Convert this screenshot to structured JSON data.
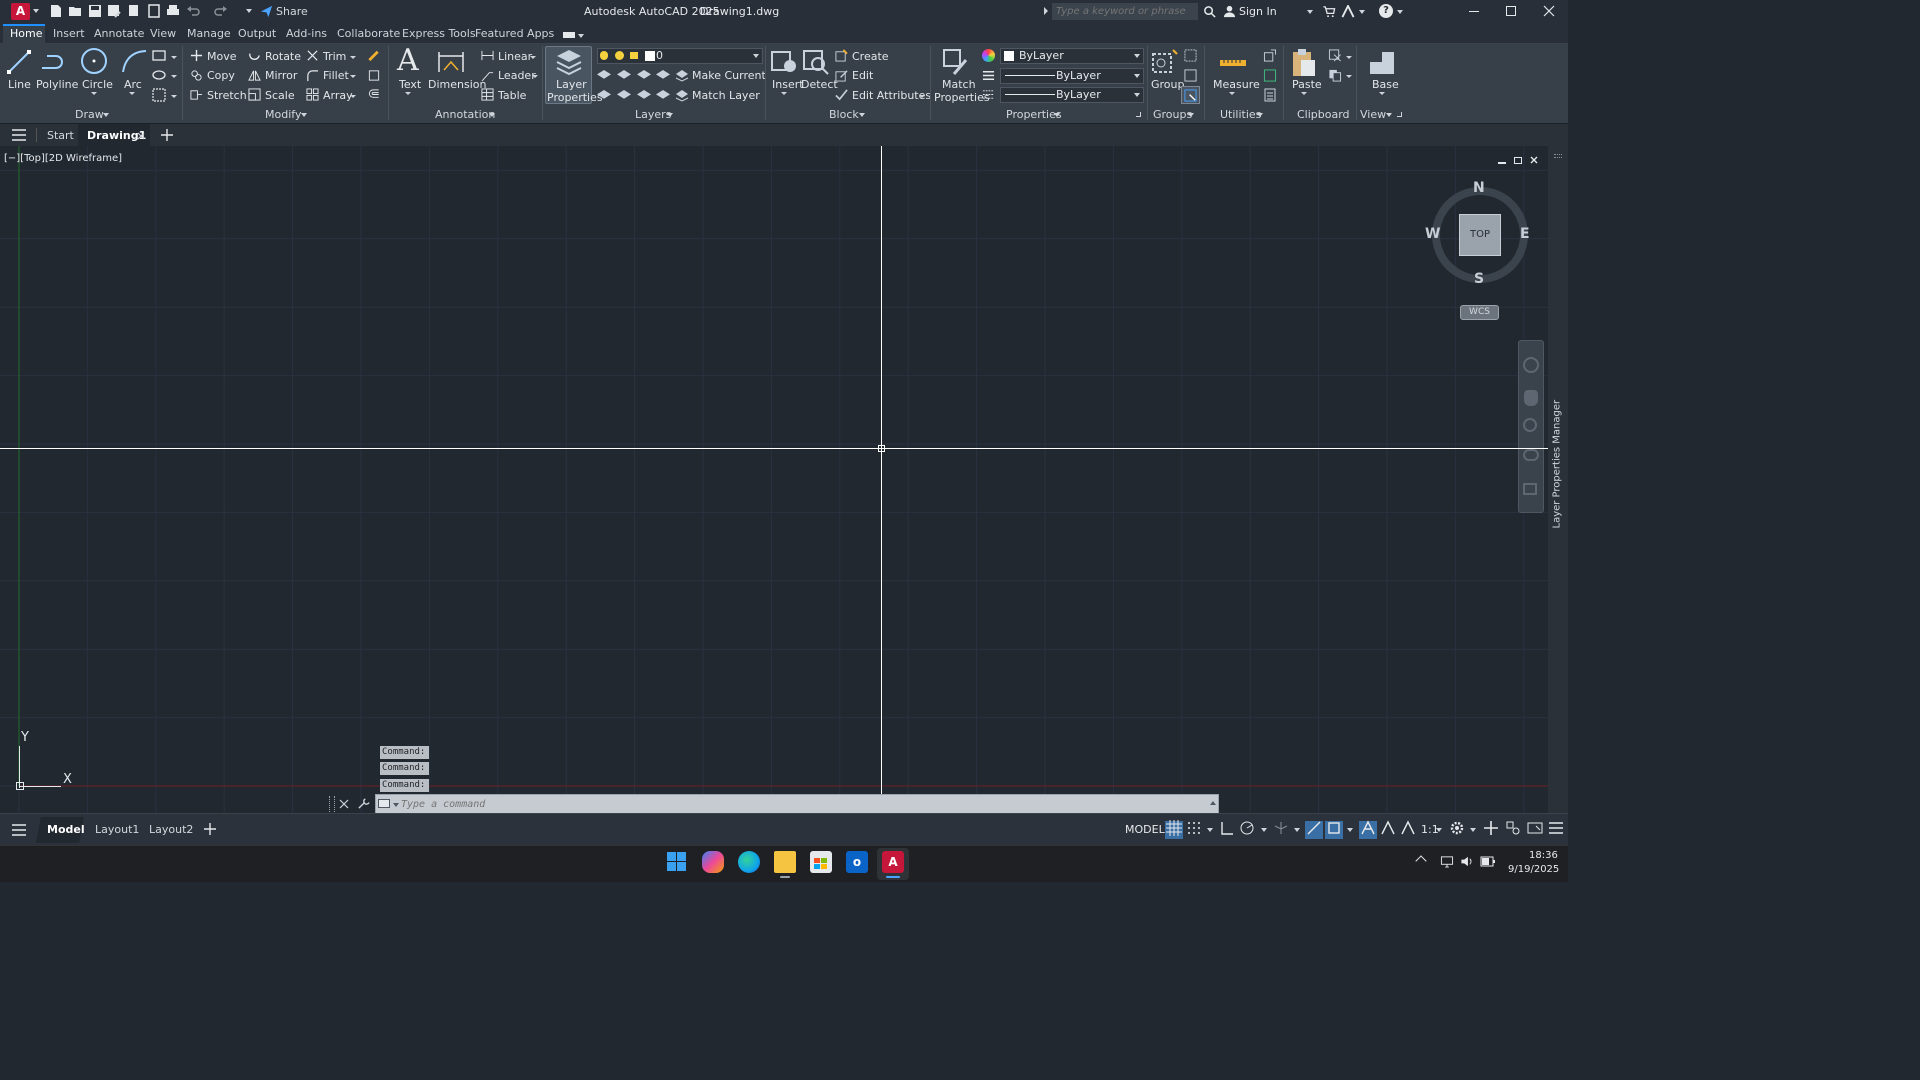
{
  "titlebar": {
    "share_label": "Share",
    "app_title": "Autodesk AutoCAD 2025",
    "file_title": "Drawing1.dwg",
    "search_placeholder": "Type a keyword or phrase",
    "sign_in": "Sign In"
  },
  "ribbon_tabs": [
    "Home",
    "Insert",
    "Annotate",
    "View",
    "Manage",
    "Output",
    "Add-ins",
    "Collaborate",
    "Express Tools",
    "Featured Apps"
  ],
  "draw": {
    "line": "Line",
    "polyline": "Polyline",
    "circle": "Circle",
    "arc": "Arc",
    "title": "Draw"
  },
  "modify": {
    "move": "Move",
    "rotate": "Rotate",
    "trim": "Trim",
    "copy": "Copy",
    "mirror": "Mirror",
    "fillet": "Fillet",
    "stretch": "Stretch",
    "scale": "Scale",
    "array": "Array",
    "title": "Modify"
  },
  "annotation": {
    "text": "Text",
    "dimension": "Dimension",
    "linear": "Linear",
    "leader": "Leader",
    "table": "Table",
    "title": "Annotation"
  },
  "layers": {
    "layer_properties_1": "Layer",
    "layer_properties_2": "Properties",
    "current_layer": "0",
    "make_current": "Make Current",
    "match_layer": "Match Layer",
    "title": "Layers"
  },
  "block": {
    "insert": "Insert",
    "detect": "Detect",
    "create": "Create",
    "edit": "Edit",
    "edit_attributes": "Edit Attributes",
    "title": "Block"
  },
  "properties": {
    "match_1": "Match",
    "match_2": "Properties",
    "color": "ByLayer",
    "linetype": "ByLayer",
    "lineweight": "ByLayer",
    "title": "Properties"
  },
  "groups": {
    "group": "Group",
    "title": "Groups"
  },
  "utilities": {
    "measure": "Measure",
    "title": "Utilities"
  },
  "clipboard": {
    "paste": "Paste",
    "title": "Clipboard"
  },
  "view_panel": {
    "base": "Base",
    "title": "View"
  },
  "file_tabs": {
    "start": "Start",
    "drawing": "Drawing1"
  },
  "viewport": {
    "label": "[−][Top][2D Wireframe]",
    "compass": {
      "n": "N",
      "s": "S",
      "e": "E",
      "w": "W",
      "top": "TOP"
    },
    "wcs": "WCS",
    "ucs_x": "X",
    "ucs_y": "Y",
    "side_palette": "Layer Properties Manager"
  },
  "command": {
    "history": [
      "Command:",
      "Command:",
      "Command:"
    ],
    "placeholder": "Type a command"
  },
  "layout_tabs": {
    "model": "Model",
    "layout1": "Layout1",
    "layout2": "Layout2"
  },
  "status": {
    "model": "MODEL",
    "scale": "1:1"
  },
  "clock": {
    "time": "18:36",
    "date": "9/19/2025"
  },
  "colors": {
    "accent": "#1e90ff",
    "grid": "#2a3240",
    "crosshair": "#ffffff",
    "y_axis": "#1f6b2a",
    "x_axis": "#6b1f24"
  }
}
